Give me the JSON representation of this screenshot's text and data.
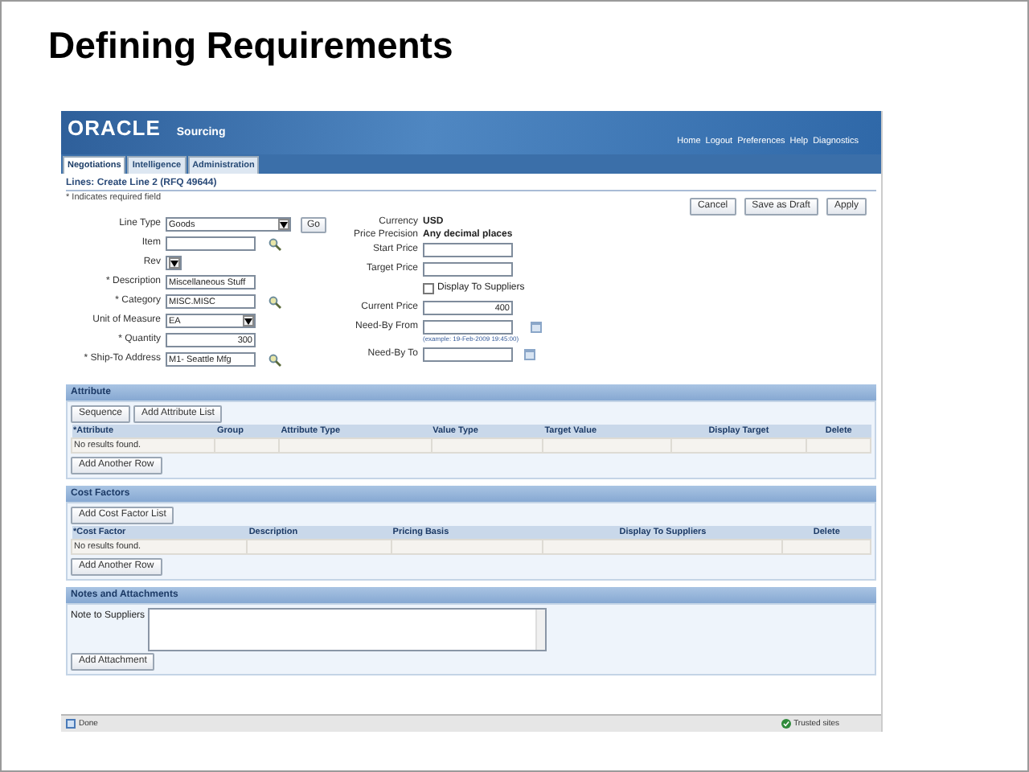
{
  "slide_title": "Defining Requirements",
  "app": {
    "logo": "ORACLE",
    "product": "Sourcing",
    "global_links": [
      "Home",
      "Logout",
      "Preferences",
      "Help",
      "Diagnostics"
    ],
    "tabs": [
      {
        "label": "Negotiations",
        "selected": true
      },
      {
        "label": "Intelligence",
        "selected": false
      },
      {
        "label": "Administration",
        "selected": false
      }
    ],
    "page_title": "Lines: Create Line 2 (RFQ 49644)",
    "required_note": "* Indicates required field",
    "buttons": [
      "Cancel",
      "Save as Draft",
      "Apply"
    ],
    "left_fields": [
      {
        "label": "Line Type",
        "kind": "select",
        "value": "Goods",
        "button": "Go"
      },
      {
        "label": "Item",
        "kind": "lov"
      },
      {
        "label": "Rev",
        "kind": "small_select"
      },
      {
        "label": "* Description",
        "kind": "text",
        "value": "Miscellaneous Stuff"
      },
      {
        "label": "* Category",
        "kind": "lov",
        "value": "MISC.MISC"
      },
      {
        "label": "Unit of Measure",
        "kind": "select",
        "value": "EA"
      },
      {
        "label": "* Quantity",
        "kind": "number",
        "value": "300"
      },
      {
        "label": "* Ship-To Address",
        "kind": "lov",
        "value": "M1- Seattle Mfg"
      }
    ],
    "right_fields": [
      {
        "label": "Currency",
        "kind": "info",
        "value": "USD"
      },
      {
        "label": "Price Precision",
        "kind": "info",
        "value": "Any decimal places"
      },
      {
        "label": "Start Price",
        "kind": "text"
      },
      {
        "label": "Target Price",
        "kind": "text"
      },
      {
        "label": "Display To Suppliers",
        "kind": "checkbox",
        "checked": false
      },
      {
        "label": "Current Price",
        "kind": "number",
        "value": "400"
      },
      {
        "label": "Need-By From",
        "kind": "date",
        "hint": "(example: 19-Feb-2009 19:45:00)"
      },
      {
        "label": "Need-By To",
        "kind": "date"
      }
    ],
    "sections": [
      {
        "title": "Attribute",
        "buttons": [
          "Sequence",
          "Add Attribute List"
        ],
        "columns": [
          "*Attribute",
          "Group",
          "Attribute Type",
          "Value Type",
          "Target Value",
          "Display Target",
          "Delete"
        ],
        "empty_text": "No results found.",
        "row_button": "Add Another Row"
      },
      {
        "title": "Cost Factors",
        "buttons": [
          "Add Cost Factor List"
        ],
        "columns": [
          "*Cost Factor",
          "Description",
          "Pricing Basis",
          "Display To Suppliers",
          "Delete"
        ],
        "empty_text": "No results found.",
        "row_button": "Add Another Row"
      },
      {
        "title": "Notes and Attachments",
        "note_label": "Note to Suppliers",
        "row_button": "Add Attachment"
      }
    ],
    "status_bar": {
      "status": "Done",
      "zone": "Trusted sites"
    }
  }
}
